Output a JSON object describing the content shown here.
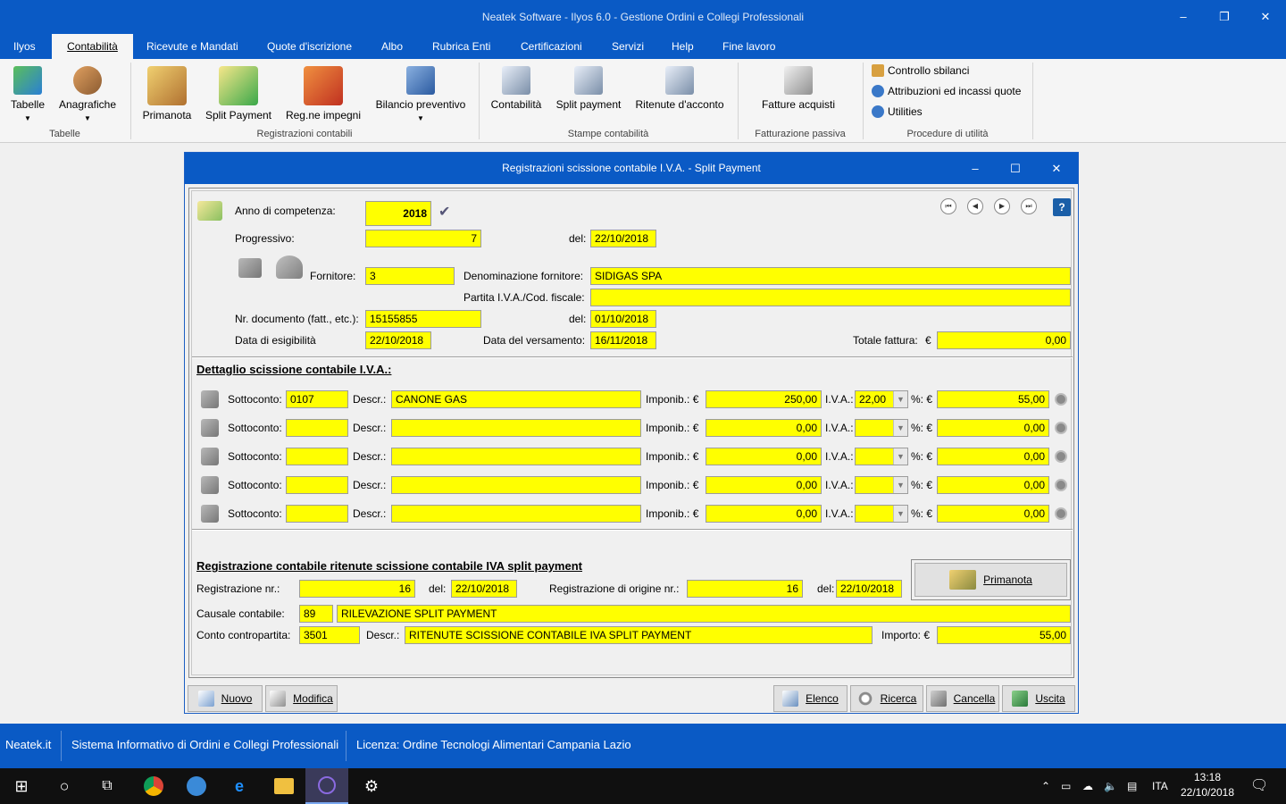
{
  "window": {
    "title": "Neatek Software - Ilyos 6.0 - Gestione Ordini e Collegi Professionali",
    "min": "–",
    "max": "❐",
    "close": "✕"
  },
  "menu": [
    "Ilyos",
    "Contabilità",
    "Ricevute e Mandati",
    "Quote d'iscrizione",
    "Albo",
    "Rubrica Enti",
    "Certificazioni",
    "Servizi",
    "Help",
    "Fine lavoro"
  ],
  "ribbon": {
    "tabelle": "Tabelle",
    "anagrafiche": "Anagrafiche",
    "group_tabelle": "Tabelle",
    "primanota": "Primanota",
    "split_payment": "Split Payment",
    "regne_impegni": "Reg.ne impegni",
    "bilancio_preventivo": "Bilancio preventivo",
    "group_registrazioni": "Registrazioni contabili",
    "stampe_contabilita": "Contabilità",
    "stampe_split": "Split payment",
    "stampe_ritenute": "Ritenute d'acconto",
    "group_stampe": "Stampe contabilità",
    "fatture_acquisti": "Fatture acquisti",
    "group_fatturazione": "Fatturazione passiva",
    "controllo_sbilanci": "Controllo sbilanci",
    "attribuzioni": "Attribuzioni ed incassi quote",
    "utilities": "Utilities",
    "group_procedure": "Procedure di utilità"
  },
  "dialog": {
    "title": "Registrazioni scissione contabile I.V.A. - Split Payment",
    "min": "–",
    "max": "☐",
    "close": "✕",
    "anno_label": "Anno di competenza:",
    "anno": "2018",
    "progressivo_label": "Progressivo:",
    "progressivo": "7",
    "del_label": "del:",
    "progressivo_data": "22/10/2018",
    "fornitore_label": "Fornitore:",
    "fornitore": "3",
    "denominazione_label": "Denominazione fornitore:",
    "denominazione": "SIDIGAS SPA",
    "piva_label": "Partita I.V.A./Cod. fiscale:",
    "piva": "",
    "nrdoc_label": "Nr. documento (fatt., etc.):",
    "nrdoc": "15155855",
    "nrdoc_data": "01/10/2018",
    "esigibilita_label": "Data di esigibilità",
    "esigibilita": "22/10/2018",
    "versamento_label": "Data del versamento:",
    "versamento": "16/11/2018",
    "totale_label": "Totale fattura:",
    "euro": "€",
    "totale": "0,00",
    "dettaglio_title": "Dettaglio scissione contabile I.V.A.:",
    "sottoconto_label": "Sottoconto:",
    "descr_label": "Descr.:",
    "imponib_label": "Imponib.: €",
    "iva_label": "I.V.A.:",
    "perc_label": "%: €",
    "rows": [
      {
        "sottoconto": "0107",
        "descr": "CANONE GAS",
        "imponibile": "250,00",
        "iva": "22,00",
        "importo": "55,00"
      },
      {
        "sottoconto": "",
        "descr": "",
        "imponibile": "0,00",
        "iva": "",
        "importo": "0,00"
      },
      {
        "sottoconto": "",
        "descr": "",
        "imponibile": "0,00",
        "iva": "",
        "importo": "0,00"
      },
      {
        "sottoconto": "",
        "descr": "",
        "imponibile": "0,00",
        "iva": "",
        "importo": "0,00"
      },
      {
        "sottoconto": "",
        "descr": "",
        "imponibile": "0,00",
        "iva": "",
        "importo": "0,00"
      }
    ],
    "registrazione_title": "Registrazione contabile ritenute scissione contabile IVA split payment",
    "regnr_label": "Registrazione nr.:",
    "regnr": "16",
    "regnr_data": "22/10/2018",
    "origine_label": "Registrazione di origine nr.:",
    "origine": "16",
    "origine_data": "22/10/2018",
    "primanota_btn": "Primanota",
    "causale_label": "Causale contabile:",
    "causale_cod": "89",
    "causale": "RILEVAZIONE SPLIT PAYMENT",
    "conto_label": "Conto contropartita:",
    "conto_cod": "3501",
    "conto_descr": "RITENUTE SCISSIONE CONTABILE IVA SPLIT PAYMENT",
    "importo_label": "Importo: €",
    "importo": "55,00",
    "btn_nuovo": "Nuovo",
    "btn_modifica": "Modifica",
    "btn_elenco": "Elenco",
    "btn_ricerca": "Ricerca",
    "btn_cancella": "Cancella",
    "btn_uscita": "Uscita"
  },
  "status": {
    "a": "Neatek.it",
    "b": "Sistema Informativo di Ordini e Collegi Professionali",
    "c": "Licenza: Ordine Tecnologi Alimentari Campania Lazio"
  },
  "taskbar": {
    "lang": "ITA",
    "time": "13:18",
    "date": "22/10/2018"
  },
  "colors": {
    "accent": "#0a5ac5",
    "field": "#ffff00"
  }
}
